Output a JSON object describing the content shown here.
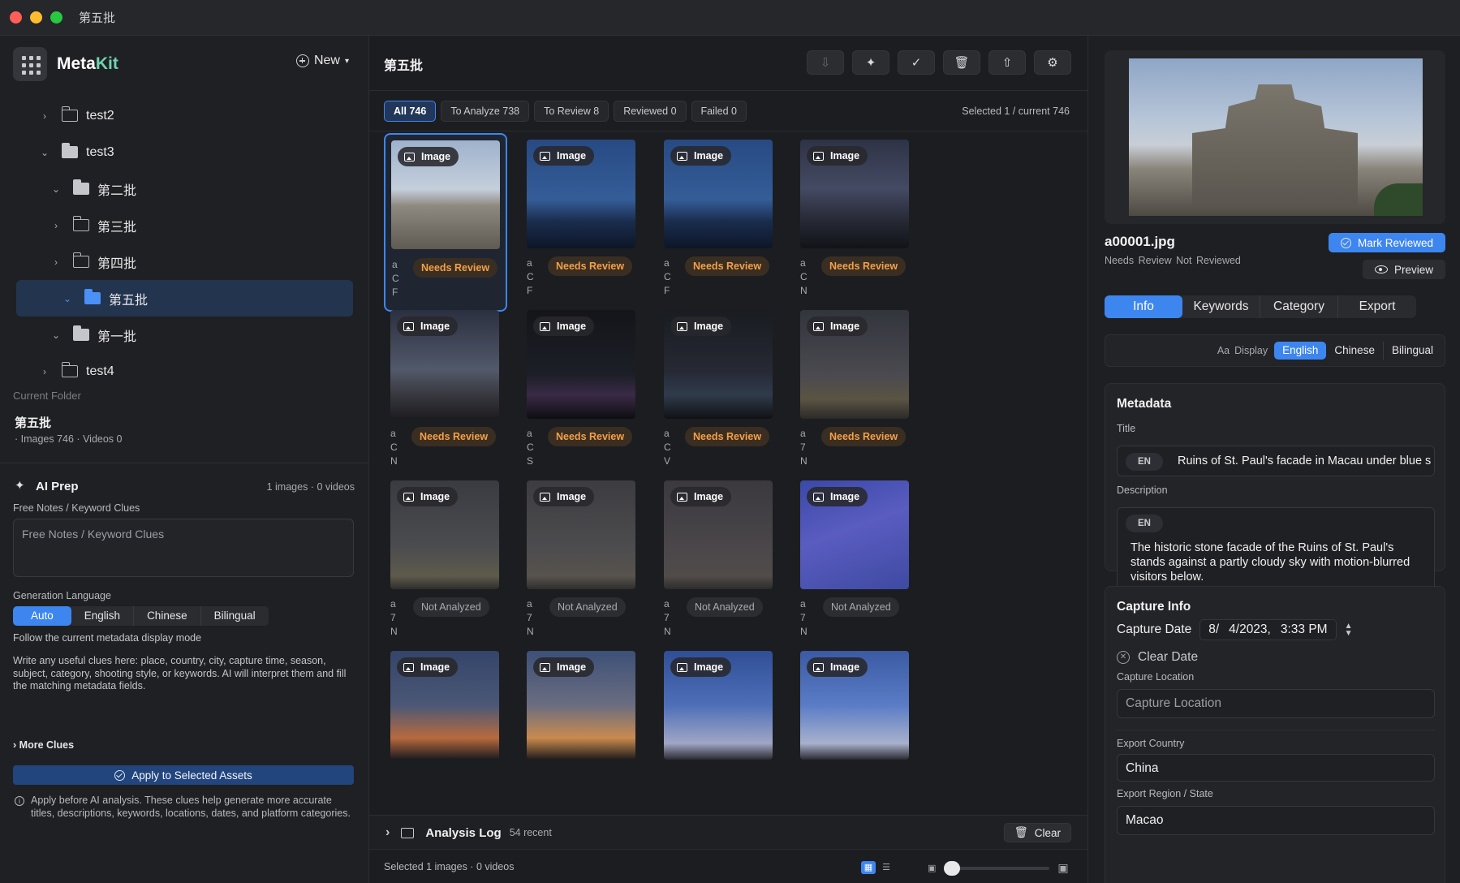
{
  "window": {
    "title": "第五批"
  },
  "brand": {
    "name_main": "Meta",
    "name_accent": "Kit",
    "new_label": "New"
  },
  "tree": [
    {
      "label": "test2",
      "chevron": "›",
      "level": 1,
      "filled": false,
      "selected": false
    },
    {
      "label": "test3",
      "chevron": "⌄",
      "level": 1,
      "filled": true,
      "selected": false
    },
    {
      "label": "第二批",
      "chevron": "⌄",
      "level": 2,
      "filled": true,
      "selected": false
    },
    {
      "label": "第三批",
      "chevron": "›",
      "level": 2,
      "filled": false,
      "selected": false
    },
    {
      "label": "第四批",
      "chevron": "›",
      "level": 2,
      "filled": false,
      "selected": false
    },
    {
      "label": "第五批",
      "chevron": "⌄",
      "level": 2,
      "filled": true,
      "selected": true
    },
    {
      "label": "第一批",
      "chevron": "⌄",
      "level": 2,
      "filled": true,
      "selected": false
    },
    {
      "label": "test4",
      "chevron": "›",
      "level": 1,
      "filled": false,
      "selected": false
    }
  ],
  "current_folder": {
    "label": "Current Folder",
    "name": "第五批",
    "counts": "· Images 746 · Videos 0"
  },
  "ai_prep": {
    "title": "AI Prep",
    "count": "1 images · 0 videos",
    "notes_label": "Free Notes / Keyword Clues",
    "notes_placeholder": "Free Notes / Keyword Clues",
    "gen_lang_label": "Generation Language",
    "lang_options": [
      "Auto",
      "English",
      "Chinese",
      "Bilingual"
    ],
    "lang_selected": "Auto",
    "follow_hint": "Follow the current metadata display mode",
    "clue_hint": "Write any useful clues here: place, country, city, capture time, season, subject, category, shooting style, or keywords. AI will interpret them and fill the matching metadata fields.",
    "more_clues": "More Clues",
    "apply_label": "Apply to Selected Assets",
    "apply_note": "Apply before AI analysis. These clues help generate more accurate titles, descriptions, keywords, locations, dates, and platform categories."
  },
  "main": {
    "title": "第五批",
    "toolbar_icons": [
      "import-icon",
      "sparkle-icon",
      "check-badge-icon",
      "trash-icon",
      "share-icon",
      "gear-icon"
    ],
    "filters": [
      {
        "label": "All 746",
        "active": true
      },
      {
        "label": "To Analyze 738",
        "active": false
      },
      {
        "label": "To Review 8",
        "active": false
      },
      {
        "label": "Reviewed 0",
        "active": false
      },
      {
        "label": "Failed 0",
        "active": false
      }
    ],
    "selected_info": "Selected 1 / current 746",
    "image_badge": "Image",
    "cards": [
      {
        "art": "art-ruins",
        "status": "Needs Review",
        "kind": "review",
        "selected": true,
        "trunc": "a\nC\nF"
      },
      {
        "art": "art-moon",
        "status": "Needs Review",
        "kind": "review",
        "selected": false,
        "trunc": "a\nC\nF"
      },
      {
        "art": "art-moon",
        "status": "Needs Review",
        "kind": "review",
        "selected": false,
        "trunc": "a\nC\nF"
      },
      {
        "art": "art-storm",
        "status": "Needs Review",
        "kind": "review",
        "selected": false,
        "trunc": "a\nC\nN"
      },
      {
        "art": "art-milky1",
        "status": "Needs Review",
        "kind": "review",
        "selected": false,
        "trunc": "a\nC\nN"
      },
      {
        "art": "art-city1",
        "status": "Needs Review",
        "kind": "review",
        "selected": false,
        "trunc": "a\nC\nS"
      },
      {
        "art": "art-city2",
        "status": "Needs Review",
        "kind": "review",
        "selected": false,
        "trunc": "a\nC\nV"
      },
      {
        "art": "art-milky2",
        "status": "Needs Review",
        "kind": "review",
        "selected": false,
        "trunc": "a\n7\nN"
      },
      {
        "art": "art-stars1",
        "status": "Not Analyzed",
        "kind": "na",
        "selected": false,
        "trunc": "a\n7\nN"
      },
      {
        "art": "art-stars2",
        "status": "Not Analyzed",
        "kind": "na",
        "selected": false,
        "trunc": "a\n7\nN"
      },
      {
        "art": "art-stars3",
        "status": "Not Analyzed",
        "kind": "na",
        "selected": false,
        "trunc": "a\n7\nN"
      },
      {
        "art": "art-blue",
        "status": "Not Analyzed",
        "kind": "na",
        "selected": false,
        "trunc": "a\n7\nN"
      },
      {
        "art": "art-sunset1",
        "status": "",
        "kind": "",
        "selected": false,
        "trunc": ""
      },
      {
        "art": "art-sunset2",
        "status": "",
        "kind": "",
        "selected": false,
        "trunc": ""
      },
      {
        "art": "art-sky1",
        "status": "",
        "kind": "",
        "selected": false,
        "trunc": ""
      },
      {
        "art": "art-sky2",
        "status": "",
        "kind": "",
        "selected": false,
        "trunc": ""
      }
    ],
    "log": {
      "title": "Analysis Log",
      "count": "54 recent",
      "clear_label": "Clear"
    },
    "status_text": "Selected 1 images · 0 videos",
    "zoom_level": 0
  },
  "inspector": {
    "file_name": "a00001.jpg",
    "file_status": "Needs Review  Not Reviewed",
    "mark_label": "Mark Reviewed",
    "preview_label": "Preview",
    "tabs": [
      "Info",
      "Keywords",
      "Category",
      "Export"
    ],
    "tab_selected": "Info",
    "display": {
      "aa": "Aa",
      "label": "Display",
      "options": [
        "English",
        "Chinese",
        "Bilingual"
      ],
      "selected": "English"
    },
    "metadata": {
      "title": "Metadata",
      "title_label": "Title",
      "lang_tag": "EN",
      "title_value": "Ruins of St. Paul's facade in Macau under blue sky",
      "desc_label": "Description",
      "desc_value": "The historic stone facade of the Ruins of St. Paul's stands against a partly cloudy sky with motion-blurred visitors below."
    },
    "capture": {
      "title": "Capture Info",
      "date_label": "Capture Date",
      "date_month": "8/",
      "date_day": "4/2023,",
      "date_time": "3:33 PM",
      "clear_date": "Clear Date",
      "location_label": "Capture Location",
      "location_placeholder": "Capture Location",
      "country_label": "Export Country",
      "country_value": "China",
      "region_label": "Export Region / State",
      "region_value": "Macao"
    }
  }
}
